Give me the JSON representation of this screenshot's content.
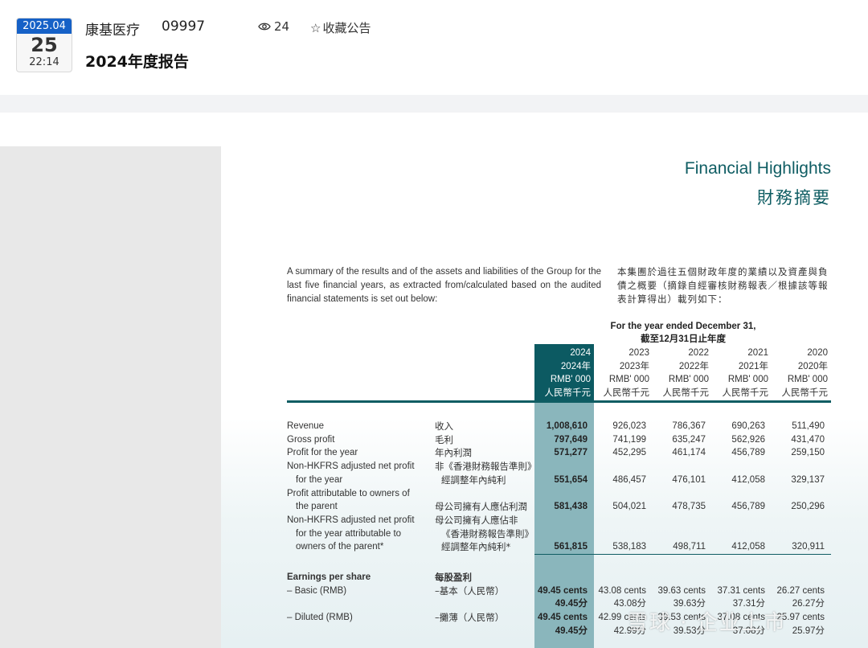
{
  "header": {
    "date_month": "2025.04",
    "date_day": "25",
    "date_time": "22:14",
    "company": "康基医疗",
    "code": "09997",
    "views": "24",
    "fav_label": "收藏公告",
    "title": "2024年度报告",
    "accent_color": "#1661c7"
  },
  "doc": {
    "heading_en": "Financial Highlights",
    "heading_zh": "財務摘要",
    "intro_en": "A summary of the results and of the assets and liabilities of the Group for the last five financial years, as extracted from/calculated based on the audited financial statements is set out below:",
    "intro_zh": "本集團於過往五個財政年度的業績以及資產與負債之概要（摘錄自經審核財務報表／根據該等報表計算得出）載列如下：",
    "year_header_en": "For the year ended December 31,",
    "year_header_zh": "截至12月31日止年度",
    "columns": [
      {
        "year": "2024",
        "year_zh": "2024年",
        "unit_en": "RMB' 000",
        "unit_zh": "人民幣千元"
      },
      {
        "year": "2023",
        "year_zh": "2023年",
        "unit_en": "RMB' 000",
        "unit_zh": "人民幣千元"
      },
      {
        "year": "2022",
        "year_zh": "2022年",
        "unit_en": "RMB' 000",
        "unit_zh": "人民幣千元"
      },
      {
        "year": "2021",
        "year_zh": "2021年",
        "unit_en": "RMB' 000",
        "unit_zh": "人民幣千元"
      },
      {
        "year": "2020",
        "year_zh": "2020年",
        "unit_en": "RMB' 000",
        "unit_zh": "人民幣千元"
      }
    ],
    "rows": [
      {
        "en": [
          "Revenue"
        ],
        "zh": [
          "收入"
        ],
        "values": [
          "1,008,610",
          "926,023",
          "786,367",
          "690,263",
          "511,490"
        ]
      },
      {
        "en": [
          "Gross profit"
        ],
        "zh": [
          "毛利"
        ],
        "values": [
          "797,649",
          "741,199",
          "635,247",
          "562,926",
          "431,470"
        ]
      },
      {
        "en": [
          "Profit for the year"
        ],
        "zh": [
          "年內利潤"
        ],
        "values": [
          "571,277",
          "452,295",
          "461,174",
          "456,789",
          "259,150"
        ]
      },
      {
        "en": [
          "Non-HKFRS adjusted net profit",
          "for the year"
        ],
        "zh": [
          "非《香港財務報告準則》",
          "經調整年內純利"
        ],
        "values": [
          "551,654",
          "486,457",
          "476,101",
          "412,058",
          "329,137"
        ]
      },
      {
        "en": [
          "Profit attributable to owners of",
          "the parent"
        ],
        "zh": [
          "",
          "母公司擁有人應佔利潤"
        ],
        "values": [
          "581,438",
          "504,021",
          "478,735",
          "456,789",
          "250,296"
        ]
      },
      {
        "en": [
          "Non-HKFRS adjusted net profit",
          "for the year attributable to",
          "owners of the parent*"
        ],
        "zh": [
          "母公司擁有人應佔非",
          "《香港財務報告準則》",
          "經調整年內純利*"
        ],
        "values": [
          "561,815",
          "538,183",
          "498,711",
          "412,058",
          "320,911"
        ]
      }
    ],
    "eps": {
      "heading_en": "Earnings per share",
      "heading_zh": "每股盈利",
      "basic_en": "– Basic (RMB)",
      "basic_zh": "–基本（人民幣）",
      "basic_cents": [
        "49.45 cents",
        "43.08 cents",
        "39.63 cents",
        "37.31 cents",
        "26.27 cents"
      ],
      "basic_fen": [
        "49.45分",
        "43.08分",
        "39.63分",
        "37.31分",
        "26.27分"
      ],
      "diluted_en": "– Diluted (RMB)",
      "diluted_zh": "–攤薄（人民幣）",
      "diluted_cents": [
        "49.45 cents",
        "42.99 cents",
        "39.53 cents",
        "37.08 cents",
        "25.97 cents"
      ],
      "diluted_fen": [
        "49.45分",
        "42.99分",
        "39.53分",
        "37.08分",
        "25.97分"
      ]
    },
    "watermark": "雪球 · 企业上市"
  }
}
